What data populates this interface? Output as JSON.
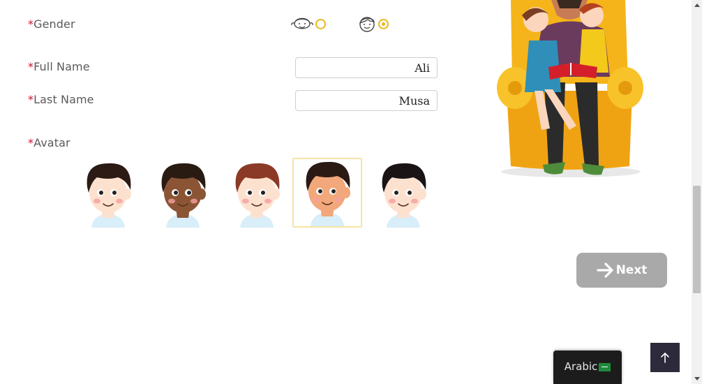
{
  "form": {
    "required_mark": "*",
    "gender_label": "Gender",
    "gender_options": [
      {
        "icon": "girl-face-icon",
        "selected": false
      },
      {
        "icon": "boy-face-icon",
        "selected": true
      }
    ],
    "full_name_label": "Full Name",
    "full_name_value": "Ali",
    "last_name_label": "Last Name",
    "last_name_value": "Musa",
    "avatar_label": "Avatar",
    "avatars": [
      {
        "name": "avatar-curly-light",
        "hair": "#2b1b14",
        "skin": "#fde1cf",
        "selected": false
      },
      {
        "name": "avatar-curly-dark",
        "hair": "#2a1b12",
        "skin": "#8b5535",
        "selected": false
      },
      {
        "name": "avatar-auburn",
        "hair": "#8a3a26",
        "skin": "#fde1cf",
        "selected": false
      },
      {
        "name": "avatar-tan",
        "hair": "#2b1a14",
        "skin": "#f2a87a",
        "selected": true
      },
      {
        "name": "avatar-black-hair",
        "hair": "#1a1414",
        "skin": "#fde1cf",
        "selected": false
      }
    ]
  },
  "actions": {
    "next_label": "Next",
    "language_label": "Arabic",
    "back_to_top_icon": "arrow-up-icon"
  },
  "colors": {
    "required": "#c8102e",
    "radio": "#e9b81f",
    "next_button": "#a9a9a9",
    "back_to_top": "#2d2a3b"
  }
}
